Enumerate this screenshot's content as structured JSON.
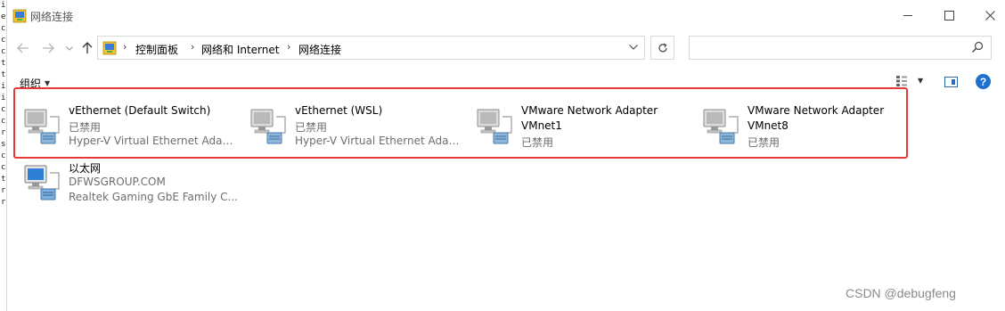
{
  "window": {
    "title": "网络连接",
    "minimize_icon": "minimize-icon",
    "maximize_icon": "maximize-icon",
    "close_icon": "close-icon"
  },
  "nav": {
    "back_icon": "arrow-left-icon",
    "forward_icon": "arrow-right-icon",
    "recent_icon": "chevron-down-icon",
    "up_icon": "arrow-up-icon"
  },
  "address": {
    "crumbs": [
      "控制面板",
      "网络和 Internet",
      "网络连接"
    ],
    "dropdown_icon": "chevron-down-icon",
    "refresh_icon": "refresh-icon"
  },
  "search": {
    "value": "",
    "icon": "search-icon"
  },
  "toolbar": {
    "organize_label": "组织",
    "organize_caret": "▼",
    "help_label": "?"
  },
  "connections": [
    {
      "name": "vEthernet (Default Switch)",
      "line2": "已禁用",
      "line3": "Hyper-V Virtual Ethernet Adap..."
    },
    {
      "name": "vEthernet (WSL)",
      "line2": "已禁用",
      "line3": "Hyper-V Virtual Ethernet Adap..."
    },
    {
      "name": "VMware Network Adapter",
      "line2": "VMnet1",
      "line3": "已禁用"
    },
    {
      "name": "VMware Network Adapter",
      "line2": "VMnet8",
      "line3": "已禁用"
    },
    {
      "name": "以太网",
      "line2": "DFWSGROUP.COM",
      "line3": "Realtek Gaming GbE Family C..."
    }
  ],
  "annotation": {
    "highlight_color": "#e53935"
  },
  "watermark": "CSDN @debugfeng",
  "colors": {
    "accent": "#1e6fd0",
    "secondary_text": "#6d6d6d"
  }
}
